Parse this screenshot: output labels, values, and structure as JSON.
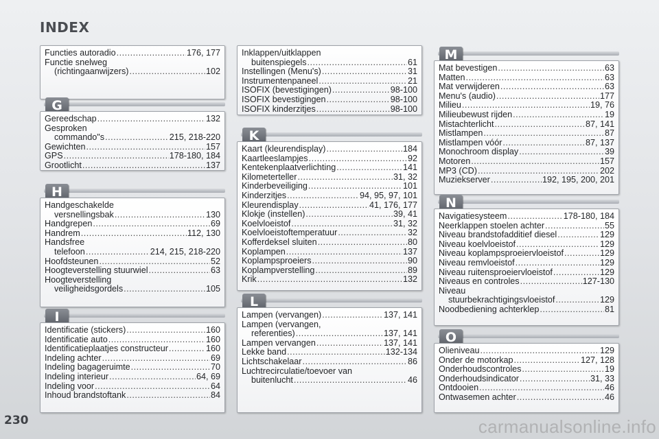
{
  "title": "INDEX",
  "page_number": "230",
  "watermark": "carmanualsonline.info",
  "column1": {
    "box_f": [
      {
        "term": "Functies autoradio",
        "pages": "176, 177",
        "indent": false
      },
      {
        "term": "Functie snelweg",
        "pages": "",
        "indent": false
      },
      {
        "term": "(richtingaanwijzers)",
        "pages": "102",
        "indent": true
      }
    ],
    "g": {
      "letter": "G",
      "entries": [
        {
          "term": "Gereedschap",
          "pages": "132",
          "indent": false
        },
        {
          "term": "Gesproken",
          "pages": "",
          "indent": false
        },
        {
          "term": "commando\"s",
          "pages": "215, 218-220",
          "indent": true
        },
        {
          "term": "Gewichten",
          "pages": "157",
          "indent": false
        },
        {
          "term": "GPS",
          "pages": "178-180, 184",
          "indent": false
        },
        {
          "term": "Grootlicht",
          "pages": "137",
          "indent": false
        }
      ]
    },
    "h": {
      "letter": "H",
      "entries": [
        {
          "term": "Handgeschakelde",
          "pages": "",
          "indent": false
        },
        {
          "term": "versnellingsbak",
          "pages": "130",
          "indent": true
        },
        {
          "term": "Handgrepen",
          "pages": "69",
          "indent": false
        },
        {
          "term": "Handrem",
          "pages": "112, 130",
          "indent": false
        },
        {
          "term": "Handsfree",
          "pages": "",
          "indent": false
        },
        {
          "term": "telefoon",
          "pages": "214, 215, 218-220",
          "indent": true
        },
        {
          "term": "Hoofdsteunen",
          "pages": "52",
          "indent": false
        },
        {
          "term": "Hoogteverstelling stuurwiel",
          "pages": "63",
          "indent": false
        },
        {
          "term": "Hoogteverstelling",
          "pages": "",
          "indent": false
        },
        {
          "term": "veiligheidsgordels",
          "pages": "105",
          "indent": true
        }
      ]
    },
    "i": {
      "letter": "I",
      "entries": [
        {
          "term": "Identificatie (stickers)",
          "pages": "160",
          "indent": false
        },
        {
          "term": "Identificatie auto",
          "pages": "160",
          "indent": false
        },
        {
          "term": "Identificatieplaatjes constructeur",
          "pages": "160",
          "indent": false
        },
        {
          "term": "Indeling achter",
          "pages": "69",
          "indent": false
        },
        {
          "term": "Indeling bagageruimte",
          "pages": "70",
          "indent": false
        },
        {
          "term": "Indeling interieur",
          "pages": "64, 69",
          "indent": false
        },
        {
          "term": "Indeling voor",
          "pages": "64",
          "indent": false
        },
        {
          "term": "Inhoud brandstoftank",
          "pages": "84",
          "indent": false
        }
      ]
    }
  },
  "column2": {
    "box_i2": [
      {
        "term": "Inklappen/uitklappen",
        "pages": "",
        "indent": false
      },
      {
        "term": "buitenspiegels",
        "pages": "61",
        "indent": true
      },
      {
        "term": "Instellingen (Menu's)",
        "pages": "31",
        "indent": false
      },
      {
        "term": "Instrumentenpaneel",
        "pages": "21",
        "indent": false
      },
      {
        "term": "ISOFIX (bevestigingen)",
        "pages": "98-100",
        "indent": false
      },
      {
        "term": "ISOFIX bevestigingen",
        "pages": "98-100",
        "indent": false
      },
      {
        "term": "ISOFIX kinderzitjes",
        "pages": "98-100",
        "indent": false
      }
    ],
    "k": {
      "letter": "K",
      "entries": [
        {
          "term": "Kaart (kleurendisplay)",
          "pages": "184",
          "indent": false
        },
        {
          "term": "Kaartleeslampjes",
          "pages": "92",
          "indent": false
        },
        {
          "term": "Kentekenplaatverlichting",
          "pages": "141",
          "indent": false
        },
        {
          "term": "Kilometerteller",
          "pages": "31, 32",
          "indent": false
        },
        {
          "term": "Kinderbeveiliging",
          "pages": "101",
          "indent": false
        },
        {
          "term": "Kinderzitjes",
          "pages": "94, 95, 97, 101",
          "indent": false
        },
        {
          "term": "Kleurendisplay",
          "pages": "41, 176, 177",
          "indent": false
        },
        {
          "term": "Klokje (instellen)",
          "pages": "39, 41",
          "indent": false
        },
        {
          "term": "Koelvloeistof",
          "pages": "31, 32",
          "indent": false
        },
        {
          "term": "Koelvloeistoftemperatuur",
          "pages": "32",
          "indent": false
        },
        {
          "term": "Kofferdeksel sluiten",
          "pages": "80",
          "indent": false
        },
        {
          "term": "Koplampen",
          "pages": "137",
          "indent": false
        },
        {
          "term": "Koplampsproeiers",
          "pages": "90",
          "indent": false
        },
        {
          "term": "Koplampverstelling",
          "pages": "89",
          "indent": false
        },
        {
          "term": "Krik",
          "pages": "132",
          "indent": false
        }
      ]
    },
    "l": {
      "letter": "L",
      "entries": [
        {
          "term": "Lampen (vervangen)",
          "pages": "137, 141",
          "indent": false
        },
        {
          "term": "Lampen (vervangen,",
          "pages": "",
          "indent": false
        },
        {
          "term": "referenties)",
          "pages": "137, 141",
          "indent": true
        },
        {
          "term": "Lampen vervangen",
          "pages": "137, 141",
          "indent": false
        },
        {
          "term": "Lekke band",
          "pages": "132-134",
          "indent": false
        },
        {
          "term": "Lichtschakelaar",
          "pages": "86",
          "indent": false
        },
        {
          "term": "Luchtrecirculatie/toevoer van",
          "pages": "",
          "indent": false
        },
        {
          "term": "buitenlucht",
          "pages": "46",
          "indent": true
        }
      ]
    }
  },
  "column3": {
    "m": {
      "letter": "M",
      "entries": [
        {
          "term": "Mat bevestigen",
          "pages": "63",
          "indent": false
        },
        {
          "term": "Matten",
          "pages": "63",
          "indent": false
        },
        {
          "term": "Mat verwijderen",
          "pages": "63",
          "indent": false
        },
        {
          "term": "Menu's (audio)",
          "pages": "177",
          "indent": false
        },
        {
          "term": "Milieu",
          "pages": "19, 76",
          "indent": false
        },
        {
          "term": "Milieubewust rijden",
          "pages": "19",
          "indent": false
        },
        {
          "term": "Mistachterlicht",
          "pages": "87, 141",
          "indent": false
        },
        {
          "term": "Mistlampen",
          "pages": "87",
          "indent": false
        },
        {
          "term": "Mistlampen vóór",
          "pages": "87, 137",
          "indent": false
        },
        {
          "term": "Monochroom display",
          "pages": "39",
          "indent": false
        },
        {
          "term": "Motoren",
          "pages": "157",
          "indent": false
        },
        {
          "term": "MP3 (CD)",
          "pages": "202",
          "indent": false
        },
        {
          "term": "Muziekserver",
          "pages": "192, 195, 200, 201",
          "indent": false
        }
      ]
    },
    "n": {
      "letter": "N",
      "entries": [
        {
          "term": "Navigatiesysteem",
          "pages": "178-180, 184",
          "indent": false
        },
        {
          "term": "Neerklappen stoelen achter",
          "pages": "55",
          "indent": false
        },
        {
          "term": "Niveau brandstofadditief diesel",
          "pages": "129",
          "indent": false
        },
        {
          "term": "Niveau koelvloeistof",
          "pages": "129",
          "indent": false
        },
        {
          "term": "Niveau koplampsproeiervloeistof",
          "pages": "129",
          "indent": false
        },
        {
          "term": "Niveau remvloeistof",
          "pages": "129",
          "indent": false
        },
        {
          "term": "Niveau ruitensproeiervloeistof",
          "pages": "129",
          "indent": false
        },
        {
          "term": "Niveaus en controles",
          "pages": "127-130",
          "indent": false
        },
        {
          "term": "Niveau",
          "pages": "",
          "indent": false
        },
        {
          "term": "stuurbekrachtigingsvloeistof",
          "pages": "129",
          "indent": true
        },
        {
          "term": "Noodbediening achterklep",
          "pages": "81",
          "indent": false
        }
      ]
    },
    "o": {
      "letter": "O",
      "entries": [
        {
          "term": "Olieniveau",
          "pages": "129",
          "indent": false
        },
        {
          "term": "Onder de motorkap",
          "pages": "127, 128",
          "indent": false
        },
        {
          "term": "Onderhoudscontroles",
          "pages": "19",
          "indent": false
        },
        {
          "term": "Onderhoudsindicator",
          "pages": "31, 33",
          "indent": false
        },
        {
          "term": "Ontdooien",
          "pages": "46",
          "indent": false
        },
        {
          "term": "Ontwasemen achter",
          "pages": "46",
          "indent": false
        }
      ]
    }
  }
}
